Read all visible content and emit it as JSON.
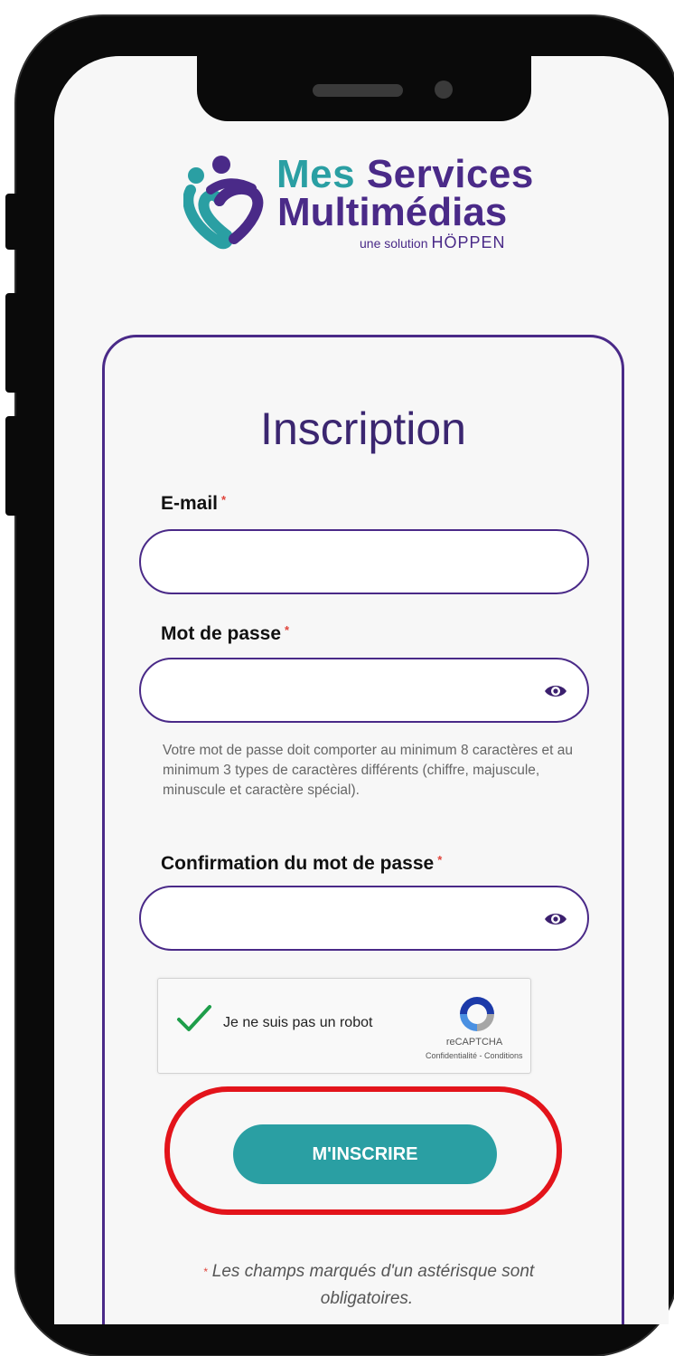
{
  "logo": {
    "line1_a": "Mes",
    "line1_b": "Services",
    "line2": "Multimédias",
    "tagline": "une solution",
    "brand": "HÖPPEN"
  },
  "form": {
    "title": "Inscription",
    "email_label": "E-mail",
    "password_label": "Mot de passe",
    "password_help": "Votre mot de passe doit comporter au minimum 8 caractères et au minimum 3 types de caractères différents (chiffre, majuscule, minuscule et caractère spécial).",
    "confirm_label": "Confirmation du mot de passe",
    "required_mark": "*",
    "submit_label": "M'INSCRIRE",
    "footnote_mark": "*",
    "footnote": "Les champs marqués d'un astérisque sont obligatoires."
  },
  "captcha": {
    "label": "Je ne suis pas un robot",
    "brand": "reCAPTCHA",
    "links": "Confidentialité - Conditions",
    "checked": true
  },
  "icons": {
    "eye": "eye-icon",
    "check": "check-icon",
    "recaptcha": "recaptcha-icon",
    "logo": "logo-mark-icon"
  },
  "colors": {
    "accent": "#2a9fa3",
    "brand_purple": "#4a2a88",
    "required": "#e0443b",
    "highlight": "#e3141b"
  }
}
